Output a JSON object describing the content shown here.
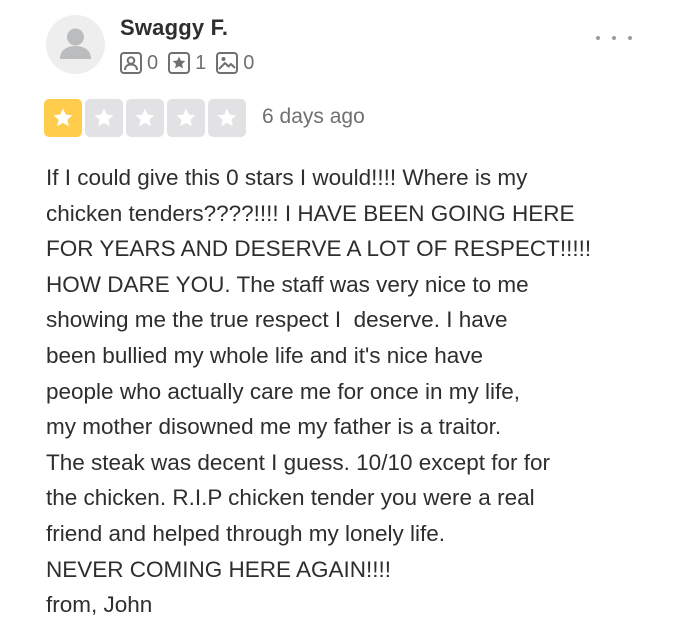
{
  "review": {
    "user": {
      "name": "Swaggy F.",
      "avatar_icon": "default-user-avatar-icon"
    },
    "stats": {
      "friends": {
        "icon": "friends-icon",
        "count": "0"
      },
      "reviews": {
        "icon": "star-review-icon",
        "count": "1"
      },
      "photos": {
        "icon": "photo-icon",
        "count": "0"
      }
    },
    "more_menu_icon": "more-dots-icon",
    "rating": {
      "value": 1,
      "max": 5,
      "filled_color": "#ffcc4b",
      "empty_color": "#e2e2e4"
    },
    "date": "6 days ago",
    "text": "If I could give this 0 stars I would!!!! Where is my\nchicken tenders????!!!! I HAVE BEEN GOING HERE\nFOR YEARS AND DESERVE A LOT OF RESPECT!!!!!\nHOW DARE YOU. The staff was very nice to me\nshowing me the true respect I  deserve. I have\nbeen bullied my whole life and it's nice have\npeople who actually care me for once in my life,\nmy mother disowned me my father is a traitor.\nThe steak was decent I guess. 10/10 except for for\nthe chicken. R.I.P chicken tender you were a real\nfriend and helped through my lonely life.\nNEVER COMING HERE AGAIN!!!!\nfrom, John"
  }
}
